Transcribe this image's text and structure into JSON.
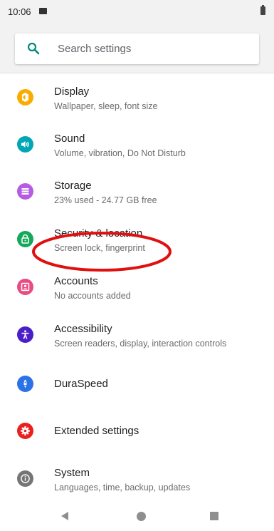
{
  "status_bar": {
    "time": "10:06"
  },
  "search": {
    "placeholder": "Search settings",
    "icon": "search-icon",
    "icon_color": "#00897b"
  },
  "settings": [
    {
      "id": "display",
      "title": "Display",
      "subtitle": "Wallpaper, sleep, font size",
      "icon": "brightness-icon",
      "color": "#f9ab00"
    },
    {
      "id": "sound",
      "title": "Sound",
      "subtitle": "Volume, vibration, Do Not Disturb",
      "icon": "volume-icon",
      "color": "#00a6b5"
    },
    {
      "id": "storage",
      "title": "Storage",
      "subtitle": "23% used - 24.77 GB free",
      "icon": "storage-icon",
      "color": "#b55be4"
    },
    {
      "id": "security",
      "title": "Security & location",
      "subtitle": "Screen lock, fingerprint",
      "icon": "lock-icon",
      "color": "#16a85a"
    },
    {
      "id": "accounts",
      "title": "Accounts",
      "subtitle": "No accounts added",
      "icon": "account-icon",
      "color": "#e94b82"
    },
    {
      "id": "accessibility",
      "title": "Accessibility",
      "subtitle": "Screen readers, display, interaction controls",
      "icon": "accessibility-icon",
      "color": "#4b1ec8"
    },
    {
      "id": "duraspeed",
      "title": "DuraSpeed",
      "subtitle": "",
      "icon": "rocket-icon",
      "color": "#2a72e8"
    },
    {
      "id": "extended",
      "title": "Extended settings",
      "subtitle": "",
      "icon": "gear-icon",
      "color": "#ea1f1f"
    },
    {
      "id": "system",
      "title": "System",
      "subtitle": "Languages, time, backup, updates",
      "icon": "info-icon",
      "color": "#757575"
    }
  ],
  "annotation": {
    "target": "security",
    "color": "#e01010"
  },
  "nav_bar": {
    "back": "back-triangle-icon",
    "home": "home-circle-icon",
    "recents": "recents-square-icon",
    "color": "#8e8e8e"
  }
}
